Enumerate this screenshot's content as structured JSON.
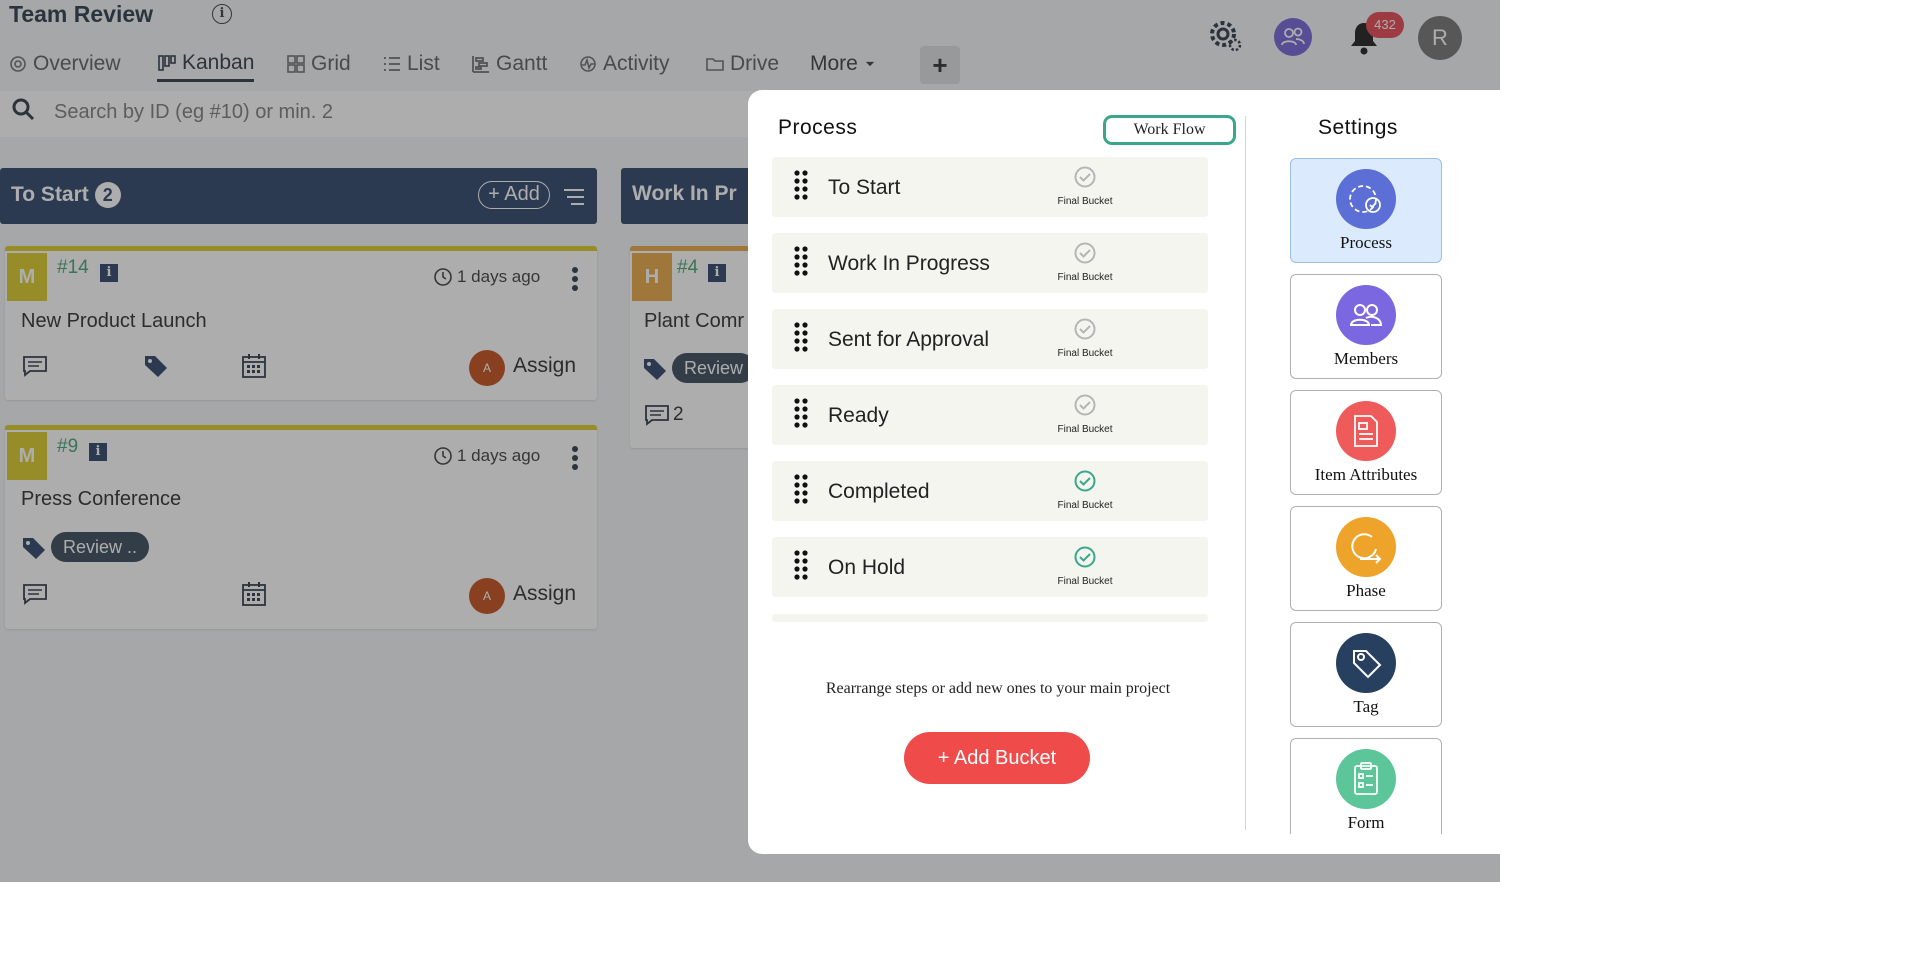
{
  "header": {
    "title": "Team Review",
    "notification_count": "432",
    "user_initial": "R"
  },
  "tabs": [
    {
      "label": "Overview",
      "icon": "overview-icon"
    },
    {
      "label": "Kanban",
      "icon": "kanban-icon",
      "active": true
    },
    {
      "label": "Grid",
      "icon": "grid-icon"
    },
    {
      "label": "List",
      "icon": "list-icon"
    },
    {
      "label": "Gantt",
      "icon": "gantt-icon"
    },
    {
      "label": "Activity",
      "icon": "activity-icon"
    },
    {
      "label": "Drive",
      "icon": "folder-icon"
    },
    {
      "label": "More",
      "icon": "chevron-down-icon"
    }
  ],
  "add_tab_label": "+",
  "search": {
    "placeholder": "Search by ID (eg #10) or min. 2"
  },
  "columns": [
    {
      "title": "To Start",
      "count": "2",
      "add_label": "+ Add",
      "cards": [
        {
          "priority": "M",
          "id": "#14",
          "time": "1 days ago",
          "title": "New Product Launch",
          "assignee_initial": "A",
          "assign_label": "Assign"
        },
        {
          "priority": "M",
          "id": "#9",
          "time": "1 days ago",
          "title": "Press Conference",
          "tag": "Review ..",
          "assignee_initial": "A",
          "assign_label": "Assign"
        }
      ]
    },
    {
      "title": "Work In Pr",
      "cards": [
        {
          "priority": "H",
          "id": "#4",
          "title": "Plant Comr",
          "tag": "Review",
          "comment_count": "2"
        }
      ]
    }
  ],
  "modal": {
    "process_title": "Process",
    "workflow_label": "Work Flow",
    "final_bucket_label": "Final Bucket",
    "buckets": [
      {
        "name": "To Start",
        "final": false
      },
      {
        "name": "Work In Progress",
        "final": false
      },
      {
        "name": "Sent for Approval",
        "final": false
      },
      {
        "name": "Ready",
        "final": false
      },
      {
        "name": "Completed",
        "final": true
      },
      {
        "name": "On Hold",
        "final": true
      }
    ],
    "hint": "Rearrange steps or add new ones to your main project",
    "add_bucket_label": "+ Add Bucket",
    "settings_title": "Settings",
    "settings": [
      {
        "label": "Process",
        "icon": "process-icon",
        "color": "#5b6fd6",
        "active": true
      },
      {
        "label": "Members",
        "icon": "members-icon",
        "color": "#7b68e0"
      },
      {
        "label": "Item Attributes",
        "icon": "item-attributes-icon",
        "color": "#ef5a5a"
      },
      {
        "label": "Phase",
        "icon": "phase-icon",
        "color": "#eea32a"
      },
      {
        "label": "Tag",
        "icon": "tag-icon",
        "color": "#27405f"
      },
      {
        "label": "Form",
        "icon": "form-icon",
        "color": "#5cc59a"
      }
    ]
  },
  "colors": {
    "column_header": "#1f3a5f",
    "priority_medium": "#d8c81a",
    "priority_high": "#e8a33a",
    "accent_green": "#3aa68c",
    "add_bucket": "#f04b4b"
  }
}
